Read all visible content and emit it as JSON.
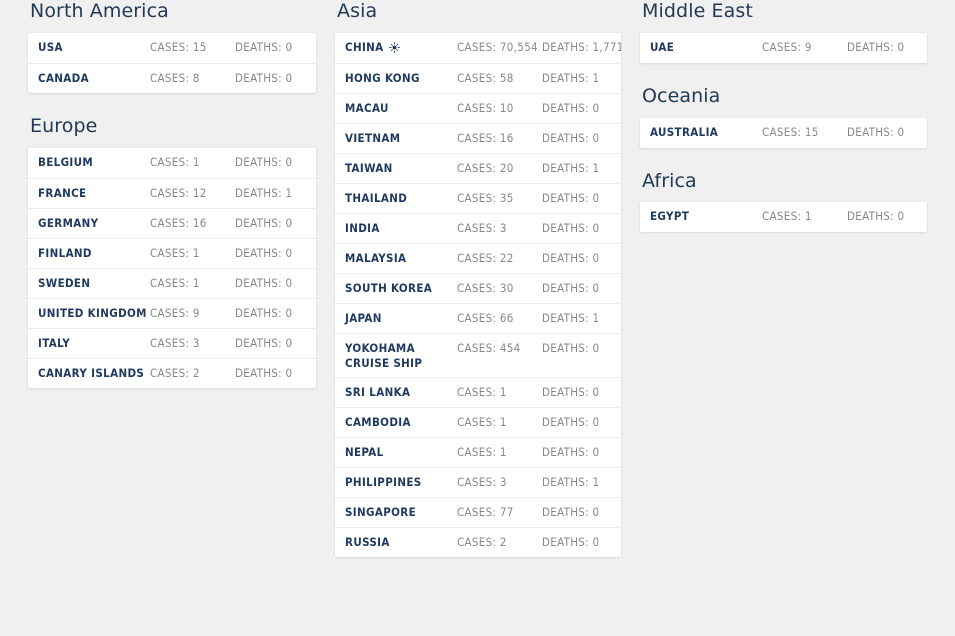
{
  "theme": {
    "page_background": "#f0f0f0",
    "card_background": "#ffffff",
    "heading_color": "#223a56",
    "country_color": "#1f3a5f",
    "metric_color": "#888888",
    "divider_color": "#ebebeb"
  },
  "labels": {
    "cases_prefix": "CASES:",
    "deaths_prefix": "DEATHS:"
  },
  "regions": [
    {
      "id": "north-america",
      "title": "North America",
      "column": 1,
      "rows": [
        {
          "name": "USA",
          "cases": "CASES: 15",
          "deaths": "DEATHS: 0"
        },
        {
          "name": "CANADA",
          "cases": "CASES: 8",
          "deaths": "DEATHS: 0"
        }
      ]
    },
    {
      "id": "europe",
      "title": "Europe",
      "column": 1,
      "rows": [
        {
          "name": "BELGIUM",
          "cases": "CASES: 1",
          "deaths": "DEATHS: 0"
        },
        {
          "name": "FRANCE",
          "cases": "CASES: 12",
          "deaths": "DEATHS: 1"
        },
        {
          "name": "GERMANY",
          "cases": "CASES: 16",
          "deaths": "DEATHS: 0"
        },
        {
          "name": "FINLAND",
          "cases": "CASES: 1",
          "deaths": "DEATHS: 0"
        },
        {
          "name": "SWEDEN",
          "cases": "CASES: 1",
          "deaths": "DEATHS: 0"
        },
        {
          "name": "UNITED KINGDOM",
          "cases": "CASES: 9",
          "deaths": "DEATHS: 0"
        },
        {
          "name": "ITALY",
          "cases": "CASES: 3",
          "deaths": "DEATHS: 0"
        },
        {
          "name": "CANARY ISLANDS",
          "cases": "CASES: 2",
          "deaths": "DEATHS: 0"
        }
      ]
    },
    {
      "id": "asia",
      "title": "Asia",
      "column": 2,
      "rows": [
        {
          "name": "CHINA",
          "cases": "CASES: 70,554",
          "deaths": "DEATHS: 1,771",
          "icon": "virus-icon"
        },
        {
          "name": "HONG KONG",
          "cases": "CASES: 58",
          "deaths": "DEATHS: 1"
        },
        {
          "name": "MACAU",
          "cases": "CASES: 10",
          "deaths": "DEATHS: 0"
        },
        {
          "name": "VIETNAM",
          "cases": "CASES: 16",
          "deaths": "DEATHS: 0"
        },
        {
          "name": "TAIWAN",
          "cases": "CASES: 20",
          "deaths": "DEATHS: 1"
        },
        {
          "name": "THAILAND",
          "cases": "CASES: 35",
          "deaths": "DEATHS: 0"
        },
        {
          "name": "INDIA",
          "cases": "CASES: 3",
          "deaths": "DEATHS: 0"
        },
        {
          "name": "MALAYSIA",
          "cases": "CASES: 22",
          "deaths": "DEATHS: 0"
        },
        {
          "name": "SOUTH KOREA",
          "cases": "CASES: 30",
          "deaths": "DEATHS: 0"
        },
        {
          "name": "JAPAN",
          "cases": "CASES: 66",
          "deaths": "DEATHS: 1"
        },
        {
          "name": "YOKOHAMA\nCRUISE SHIP",
          "cases": "CASES: 454",
          "deaths": "DEATHS: 0"
        },
        {
          "name": "SRI LANKA",
          "cases": "CASES: 1",
          "deaths": "DEATHS: 0"
        },
        {
          "name": "CAMBODIA",
          "cases": "CASES: 1",
          "deaths": "DEATHS: 0"
        },
        {
          "name": "NEPAL",
          "cases": "CASES: 1",
          "deaths": "DEATHS: 0"
        },
        {
          "name": "PHILIPPINES",
          "cases": "CASES: 3",
          "deaths": "DEATHS: 1"
        },
        {
          "name": "SINGAPORE",
          "cases": "CASES: 77",
          "deaths": "DEATHS: 0"
        },
        {
          "name": "RUSSIA",
          "cases": "CASES: 2",
          "deaths": "DEATHS: 0"
        }
      ]
    },
    {
      "id": "middle-east",
      "title": "Middle East",
      "column": 3,
      "rows": [
        {
          "name": "UAE",
          "cases": "CASES: 9",
          "deaths": "DEATHS: 0"
        }
      ]
    },
    {
      "id": "oceania",
      "title": "Oceania",
      "column": 3,
      "rows": [
        {
          "name": "AUSTRALIA",
          "cases": "CASES: 15",
          "deaths": "DEATHS: 0"
        }
      ]
    },
    {
      "id": "africa",
      "title": "Africa",
      "column": 3,
      "rows": [
        {
          "name": "EGYPT",
          "cases": "CASES: 1",
          "deaths": "DEATHS: 0"
        }
      ]
    }
  ]
}
